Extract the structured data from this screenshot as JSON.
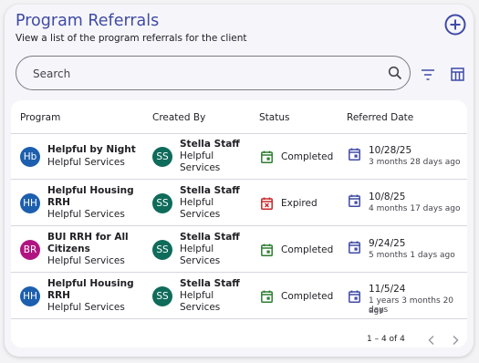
{
  "header": {
    "title": "Program Referrals",
    "subtitle": "View a list of the program referrals for the client"
  },
  "search": {
    "placeholder": "Search"
  },
  "icons": {
    "add": "plus-circle-icon",
    "search": "magnifier-icon",
    "filter": "filter-lines-icon",
    "columns": "table-columns-icon",
    "status": "calendar-check-icon",
    "date": "calendar-icon"
  },
  "colors": {
    "accent": "#3f4aa6",
    "avatar_blue": "#1c5fae",
    "avatar_green": "#0f6b5a",
    "avatar_magenta": "#b01480",
    "status_completed": "#2e7d32",
    "status_expired": "#c62828",
    "date_icon": "#3f4aa6"
  },
  "table": {
    "columns": [
      "Program",
      "Created By",
      "Status",
      "Referred Date"
    ],
    "rows": [
      {
        "program_initials": "Hb",
        "program_line1": "Helpful by Night",
        "program_line2": "",
        "program_org": "Helpful Services",
        "creator_initials": "SS",
        "creator_name": "Stella Staff",
        "creator_org_line1": "Helpful",
        "creator_org_line2": "Services",
        "status": "Completed",
        "date": "10/28/25",
        "relative_line1": "3 months 28 days ago",
        "relative_line2": ""
      },
      {
        "program_initials": "HH",
        "program_line1": "Helpful Housing",
        "program_line2": "RRH",
        "program_org": "Helpful Services",
        "creator_initials": "SS",
        "creator_name": "Stella Staff",
        "creator_org_line1": "Helpful",
        "creator_org_line2": "Services",
        "status": "Expired",
        "date": "10/8/25",
        "relative_line1": "4 months 17 days ago",
        "relative_line2": ""
      },
      {
        "program_initials": "BR",
        "program_line1": "BUI RRH for All",
        "program_line2": "Citizens",
        "program_org": "Helpful Services",
        "creator_initials": "SS",
        "creator_name": "Stella Staff",
        "creator_org_line1": "Helpful",
        "creator_org_line2": "Services",
        "status": "Completed",
        "date": "9/24/25",
        "relative_line1": "5 months 1 days ago",
        "relative_line2": ""
      },
      {
        "program_initials": "HH",
        "program_line1": "Helpful Housing",
        "program_line2": "RRH",
        "program_org": "Helpful Services",
        "creator_initials": "SS",
        "creator_name": "Stella Staff",
        "creator_org_line1": "Helpful",
        "creator_org_line2": "Services",
        "status": "Completed",
        "date": "11/5/24",
        "relative_line1": "1 years 3 months 20 days",
        "relative_line2": "ago"
      }
    ]
  },
  "pagination": {
    "range": "1 – 4 of 4"
  }
}
